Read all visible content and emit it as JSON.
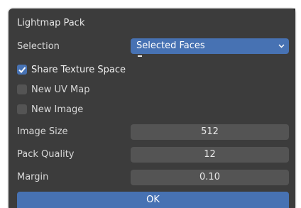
{
  "dialog": {
    "title": "Lightmap Pack",
    "selection": {
      "label": "Selection",
      "value": "Selected Faces"
    },
    "share_texture_space": {
      "label": "Share Texture Space",
      "checked": true
    },
    "new_uv_map": {
      "label": "New UV Map",
      "checked": false
    },
    "new_image": {
      "label": "New Image",
      "checked": false
    },
    "image_size": {
      "label": "Image Size",
      "value": "512"
    },
    "pack_quality": {
      "label": "Pack Quality",
      "value": "12"
    },
    "margin": {
      "label": "Margin",
      "value": "0.10"
    },
    "ok_label": "OK"
  },
  "colors": {
    "panel_bg": "#3c3c3c",
    "accent": "#4772b3",
    "field_bg": "#545454",
    "text": "#d8d8d8"
  }
}
